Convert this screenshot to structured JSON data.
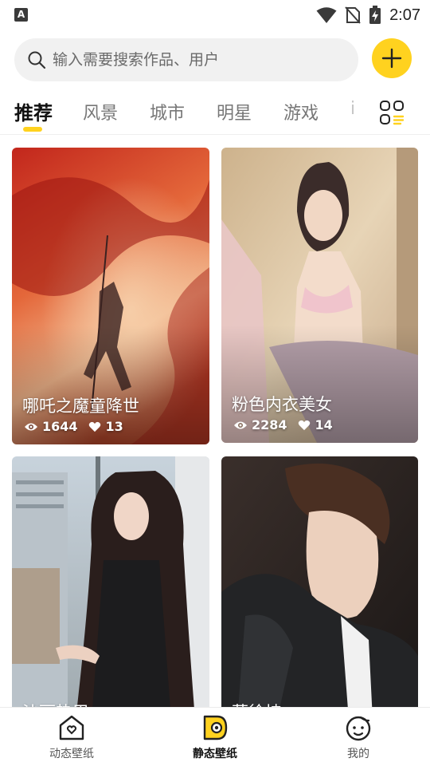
{
  "status_bar": {
    "left_badge": "A",
    "time": "2:07",
    "icons": [
      "notification-a-icon",
      "wifi-icon",
      "no-sim-icon",
      "battery-charging-icon"
    ]
  },
  "search": {
    "placeholder": "输入需要搜索作品、用户",
    "value": ""
  },
  "add_button": {
    "icon": "plus-icon",
    "color": "#ffd21f"
  },
  "tabs": [
    {
      "label": "推荐",
      "active": true
    },
    {
      "label": "风景",
      "active": false
    },
    {
      "label": "城市",
      "active": false
    },
    {
      "label": "明星",
      "active": false
    },
    {
      "label": "游戏",
      "active": false
    },
    {
      "label": "i",
      "active": false
    }
  ],
  "category_button": {
    "icon": "category-grid-icon"
  },
  "cards": [
    {
      "title": "哪吒之魔童降世",
      "views": "1644",
      "likes": "13"
    },
    {
      "title": "粉色内衣美女",
      "views": "2284",
      "likes": "14"
    },
    {
      "title": "沙丽热巴",
      "views": "",
      "likes": ""
    },
    {
      "title": "蔡徐坤",
      "views": "",
      "likes": ""
    }
  ],
  "bottom_nav": [
    {
      "label": "动态壁纸",
      "icon": "home-dynamic-icon",
      "active": false
    },
    {
      "label": "静态壁纸",
      "icon": "static-wallpaper-icon",
      "active": true
    },
    {
      "label": "我的",
      "icon": "profile-face-icon",
      "active": false
    }
  ],
  "colors": {
    "accent": "#ffd21f",
    "tab_active": "#111111",
    "tab_inactive": "#777777"
  }
}
